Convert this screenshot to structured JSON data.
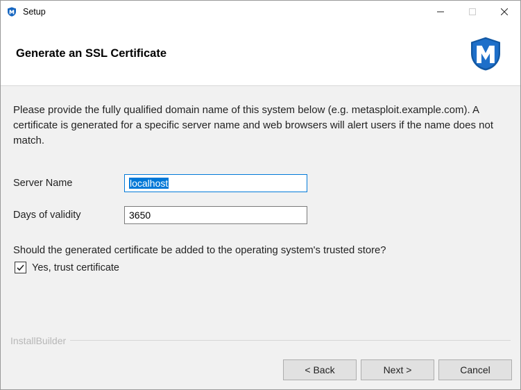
{
  "window": {
    "title": "Setup"
  },
  "header": {
    "title": "Generate an SSL Certificate"
  },
  "body": {
    "description": "Please provide the fully qualified domain name of this system below (e.g. metasploit.example.com). A certificate is generated for a specific server name and web browsers will alert users if the name does not match.",
    "fields": {
      "server_name": {
        "label": "Server Name",
        "value": "localhost"
      },
      "days_validity": {
        "label": "Days of validity",
        "value": "3650"
      }
    },
    "question": "Should the generated certificate be added to the operating system's trusted store?",
    "checkbox": {
      "label": "Yes, trust certificate",
      "checked": true
    }
  },
  "brand": "InstallBuilder",
  "buttons": {
    "back": "< Back",
    "next": "Next >",
    "cancel": "Cancel"
  }
}
